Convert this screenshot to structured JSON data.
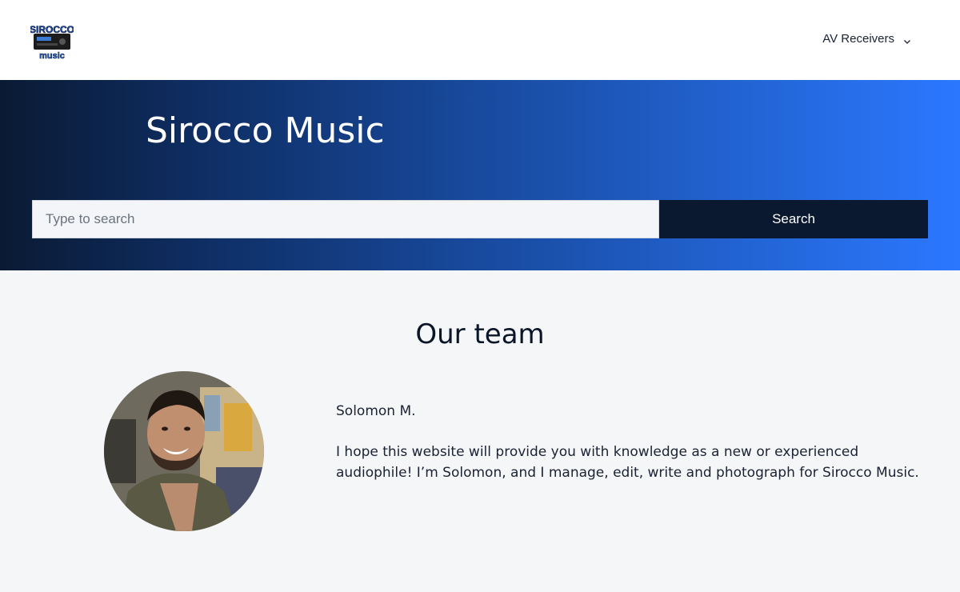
{
  "header": {
    "logo_text_top": "SIROCCO",
    "logo_text_bottom": "music",
    "nav_menu_label": "AV Receivers",
    "nav_menu_icon": "chevron-down-icon"
  },
  "hero": {
    "title": "Sirocco Music",
    "search": {
      "placeholder": "Type to search",
      "value": "",
      "button_label": "Search"
    }
  },
  "team": {
    "heading": "Our team",
    "members": [
      {
        "name": "Solomon M.",
        "bio": "I hope this website will provide you with knowledge as a new or experienced audiophile! I’m Solomon, and I manage, edit, write and photograph for Sirocco Music."
      }
    ]
  },
  "colors": {
    "hero_gradient_start": "#0a1a33",
    "hero_gradient_end": "#2b78ff",
    "search_button_bg": "#0a1830",
    "page_bg": "#f5f6f8"
  }
}
